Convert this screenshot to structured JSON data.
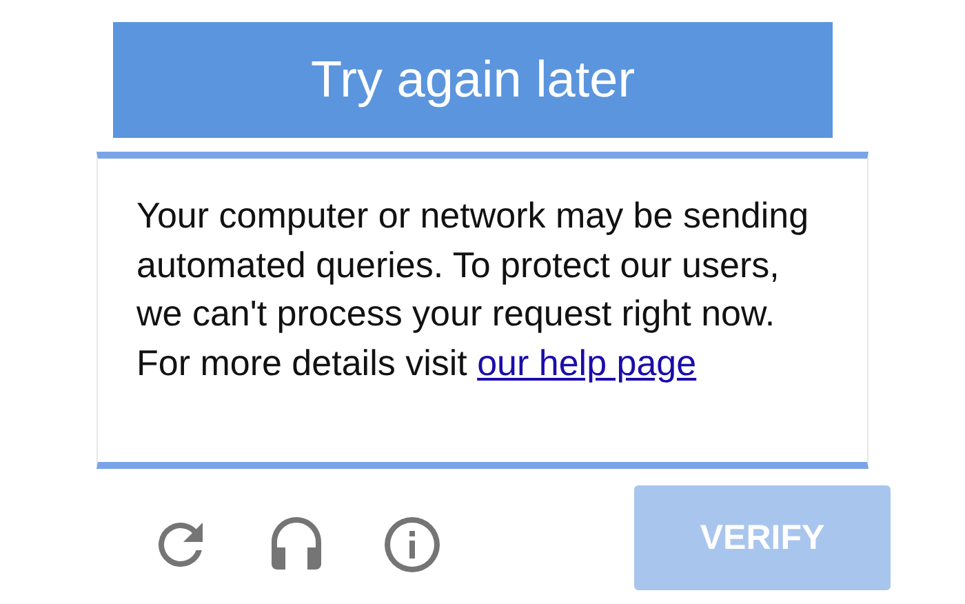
{
  "header": {
    "title": "Try again later"
  },
  "message": {
    "text": "Your computer or network may be sending automated queries. To protect our users, we can't process your request right now. For more details visit",
    "link": "our help page"
  },
  "verify_button": {
    "label": "VERIFY",
    "disabled": true
  }
}
